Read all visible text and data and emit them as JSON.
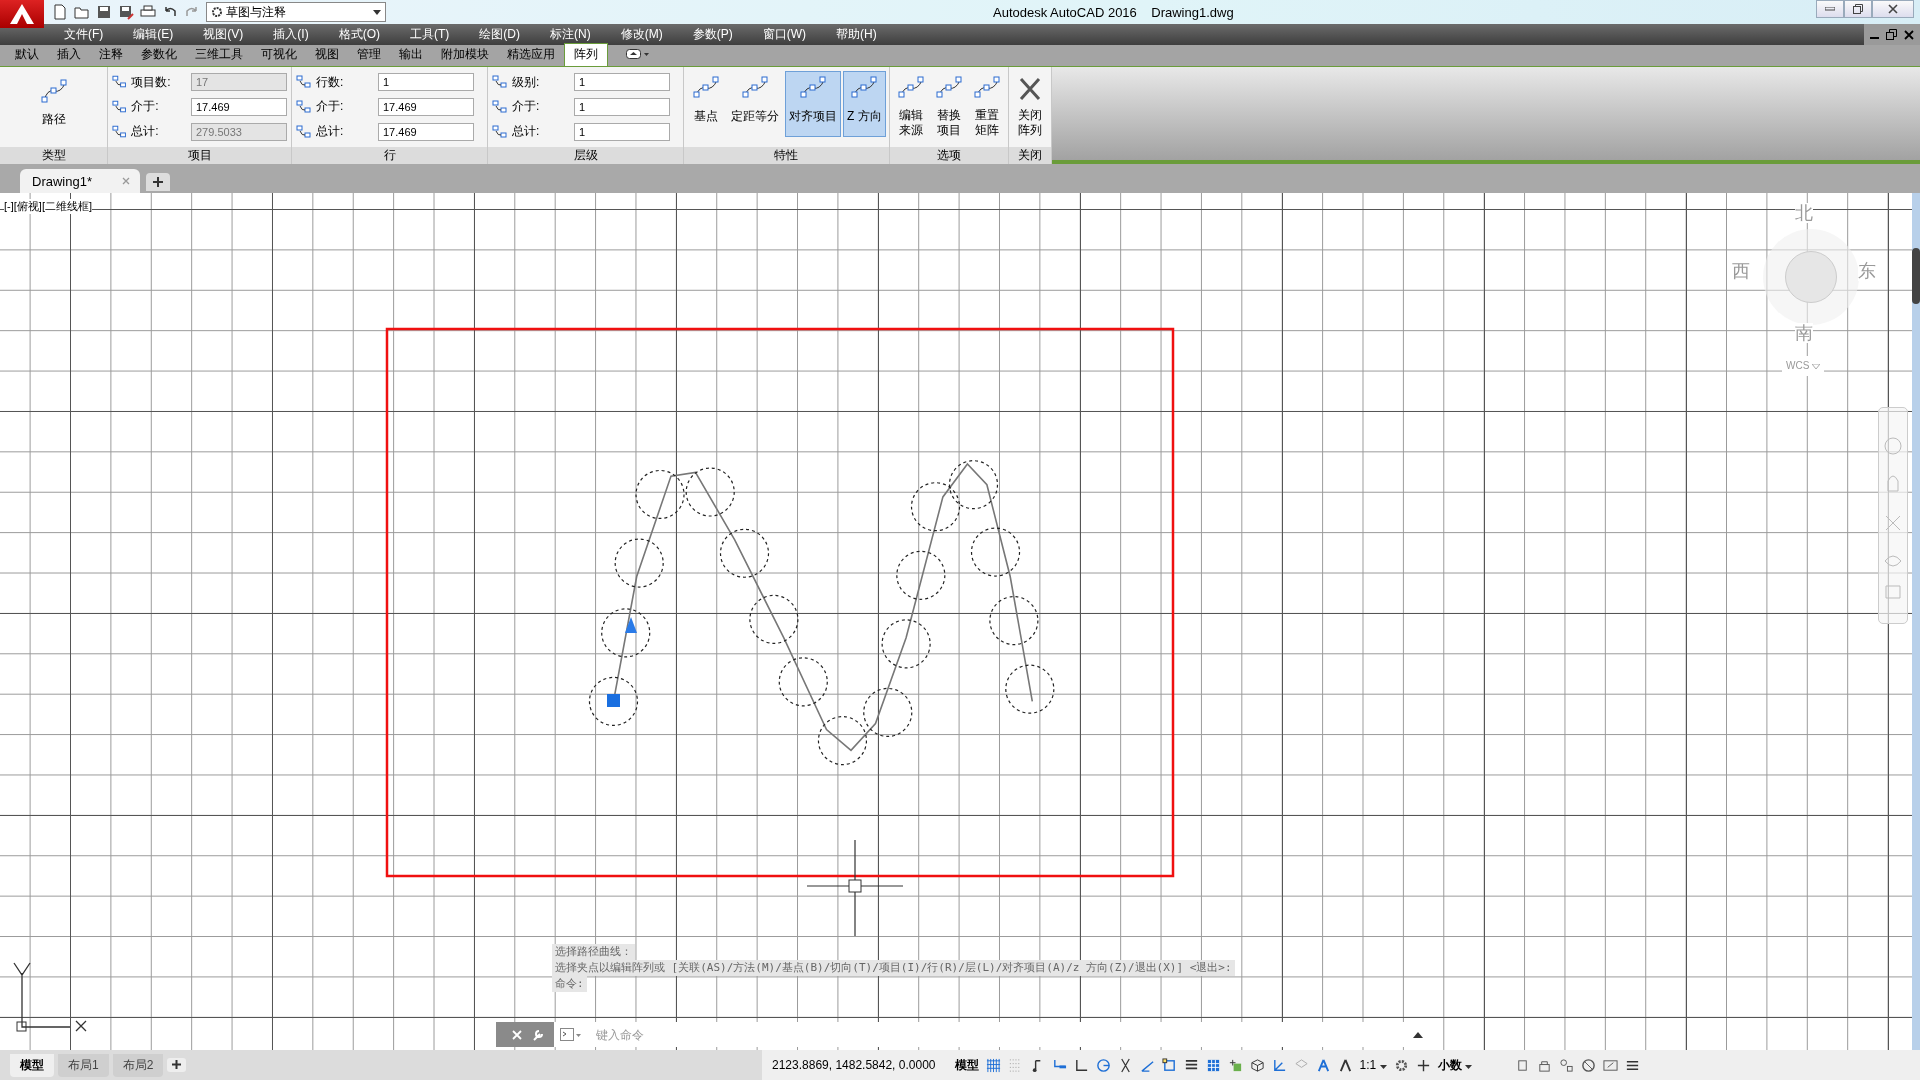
{
  "window": {
    "title": "Autodesk AutoCAD 2016",
    "document": "Drawing1.dwg"
  },
  "quick_access": {
    "workspace": "草图与注释"
  },
  "menu": [
    "文件(F)",
    "编辑(E)",
    "视图(V)",
    "插入(I)",
    "格式(O)",
    "工具(T)",
    "绘图(D)",
    "标注(N)",
    "修改(M)",
    "参数(P)",
    "窗口(W)",
    "帮助(H)"
  ],
  "ribbon_tabs": [
    {
      "label": "默认",
      "selected": false
    },
    {
      "label": "插入",
      "selected": false
    },
    {
      "label": "注释",
      "selected": false
    },
    {
      "label": "参数化",
      "selected": false
    },
    {
      "label": "三维工具",
      "selected": false
    },
    {
      "label": "可视化",
      "selected": false
    },
    {
      "label": "视图",
      "selected": false
    },
    {
      "label": "管理",
      "selected": false
    },
    {
      "label": "输出",
      "selected": false
    },
    {
      "label": "附加模块",
      "selected": false
    },
    {
      "label": "精选应用",
      "selected": false
    },
    {
      "label": "阵列",
      "selected": true
    }
  ],
  "ribbon": {
    "type_panel": {
      "label": "类型",
      "button": "路径"
    },
    "item_panel": {
      "label": "项目",
      "fields": [
        {
          "label": "项目数:",
          "value": "17",
          "disabled": true
        },
        {
          "label": "介于:",
          "value": "17.469",
          "disabled": false
        },
        {
          "label": "总计:",
          "value": "279.5033",
          "disabled": true
        }
      ]
    },
    "row_panel": {
      "label": "行",
      "fields": [
        {
          "label": "行数:",
          "value": "1",
          "disabled": false
        },
        {
          "label": "介于:",
          "value": "17.469",
          "disabled": false
        },
        {
          "label": "总计:",
          "value": "17.469",
          "disabled": false
        }
      ]
    },
    "level_panel": {
      "label": "层级",
      "fields": [
        {
          "label": "级别:",
          "value": "1",
          "disabled": false
        },
        {
          "label": "介于:",
          "value": "1",
          "disabled": false
        },
        {
          "label": "总计:",
          "value": "1",
          "disabled": false
        }
      ]
    },
    "properties_panel": {
      "label": "特性",
      "buttons": [
        {
          "label": "基点",
          "selected": false
        },
        {
          "label": "定距等分",
          "selected": false
        },
        {
          "label": "对齐项目",
          "selected": true
        },
        {
          "label": "Z 方向",
          "selected": true
        }
      ]
    },
    "options_panel": {
      "label": "选项",
      "buttons": [
        "编辑来源",
        "替换项目",
        "重置矩阵"
      ]
    },
    "close_panel": {
      "label": "关闭",
      "button": "关闭阵列"
    }
  },
  "file_tab": {
    "label": "Drawing1*"
  },
  "viewport_label": "[-][俯视][二维线框]",
  "viewcube": {
    "north": "北",
    "west": "西",
    "east": "东",
    "south": "南",
    "ucs": "WCS"
  },
  "command_history": [
    "选择路径曲线：",
    "选择夹点以编辑阵列或 [关联(AS)/方法(M)/基点(B)/切向(T)/项目(I)/行(R)/层(L)/对齐项目(A)/z 方向(Z)/退出(X)] <退出>:",
    "命令:"
  ],
  "command_line": {
    "placeholder": "键入命令"
  },
  "layout_tabs": [
    {
      "label": "模型",
      "selected": true
    },
    {
      "label": "布局1",
      "selected": false
    },
    {
      "label": "布局2",
      "selected": false
    }
  ],
  "status_bar": {
    "coordinates": "2123.8869, 1482.5842, 0.0000",
    "space": "模型",
    "scale": "1:1",
    "units": "小数"
  }
}
